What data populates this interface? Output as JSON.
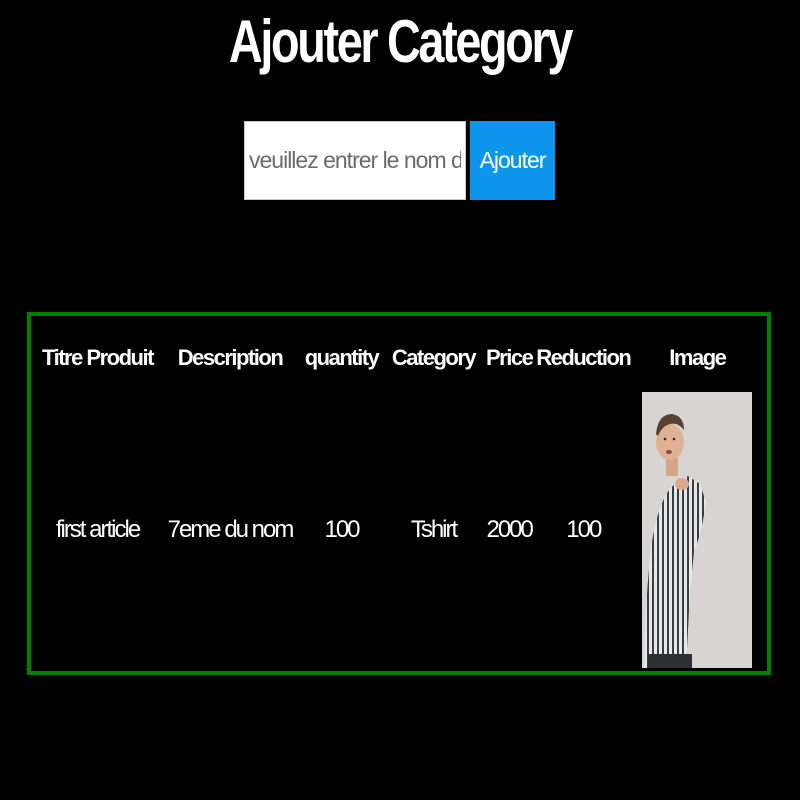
{
  "page": {
    "title": "Ajouter Category"
  },
  "form": {
    "input_placeholder": "veuillez entrer le nom du c",
    "input_value": "",
    "submit_label": "Ajouter"
  },
  "colors": {
    "background": "#000000",
    "button": "#0d96eb",
    "table_border": "#008000",
    "image_background": "#d9d4d4"
  },
  "table": {
    "headers": [
      "Titre Produit",
      "Description",
      "quantity",
      "Category",
      "Price",
      "Reduction",
      "Image"
    ],
    "rows": [
      {
        "title": "first article",
        "description": "7eme du nom",
        "quantity": "100",
        "category": "Tshirt",
        "price": "2000",
        "reduction": "100",
        "image": "product-photo-man-striped-shirt"
      }
    ]
  }
}
